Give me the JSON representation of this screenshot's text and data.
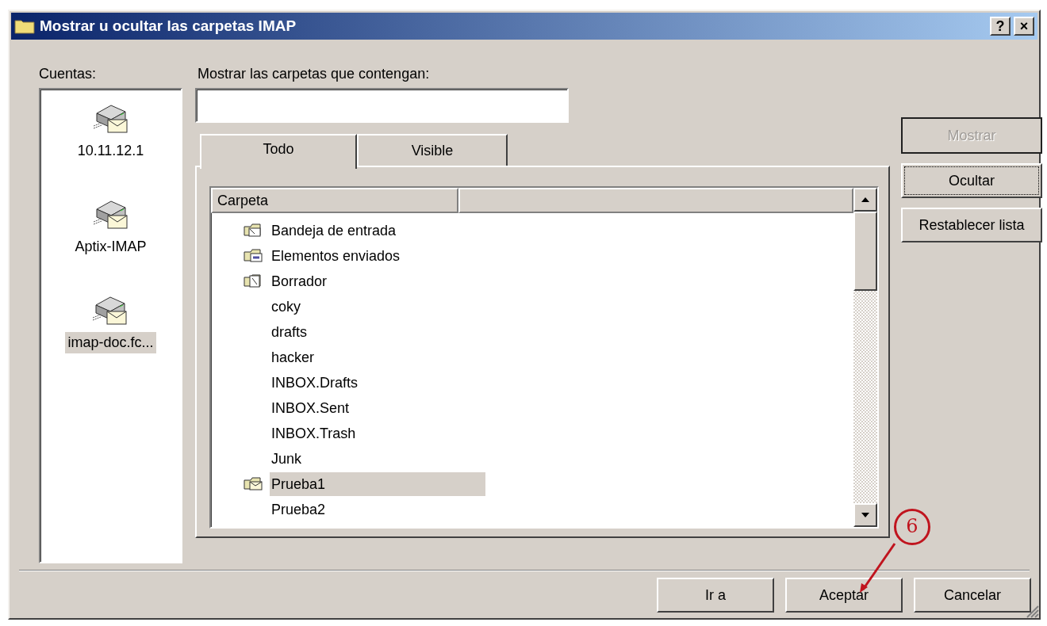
{
  "window": {
    "title": "Mostrar u ocultar las carpetas IMAP",
    "buttons": [
      {
        "label": "?"
      },
      {
        "label": "×"
      }
    ]
  },
  "accounts": {
    "label": "Cuentas:",
    "items": [
      {
        "name": "10.11.12.1",
        "selected": false
      },
      {
        "name": "Aptix-IMAP",
        "selected": false
      },
      {
        "name": "imap-doc.fc...",
        "selected": true
      }
    ]
  },
  "filter": {
    "label": "Mostrar las carpetas que contengan:"
  },
  "tabs": [
    {
      "label": "Todo",
      "selected": true
    },
    {
      "label": "Visible",
      "selected": false
    }
  ],
  "folders": {
    "columns": [
      "Carpeta"
    ],
    "rows": [
      {
        "name": "Bandeja de entrada",
        "kind": "inbox",
        "selected": false
      },
      {
        "name": "Elementos enviados",
        "kind": "sent",
        "selected": false
      },
      {
        "name": "Borrador",
        "kind": "drafts",
        "selected": false
      },
      {
        "name": "coky",
        "kind": "plain",
        "selected": false
      },
      {
        "name": "drafts",
        "kind": "plain",
        "selected": false
      },
      {
        "name": "hacker",
        "kind": "plain",
        "selected": false
      },
      {
        "name": "INBOX.Drafts",
        "kind": "plain",
        "selected": false
      },
      {
        "name": "INBOX.Sent",
        "kind": "plain",
        "selected": false
      },
      {
        "name": "INBOX.Trash",
        "kind": "plain",
        "selected": false
      },
      {
        "name": "Junk",
        "kind": "plain",
        "selected": false
      },
      {
        "name": "Prueba1",
        "kind": "mail",
        "selected": true
      },
      {
        "name": "Prueba2",
        "kind": "plain",
        "selected": false
      }
    ]
  },
  "side_buttons": [
    {
      "label": "Mostrar",
      "disabled": true,
      "focused": false
    },
    {
      "label": "Ocultar",
      "disabled": false,
      "focused": true
    },
    {
      "label": "Restablecer lista",
      "disabled": false,
      "focused": false
    }
  ],
  "bottom_buttons": [
    {
      "label": "Ir a"
    },
    {
      "label": "Aceptar"
    },
    {
      "label": "Cancelar"
    }
  ],
  "callout": {
    "label": "6"
  }
}
